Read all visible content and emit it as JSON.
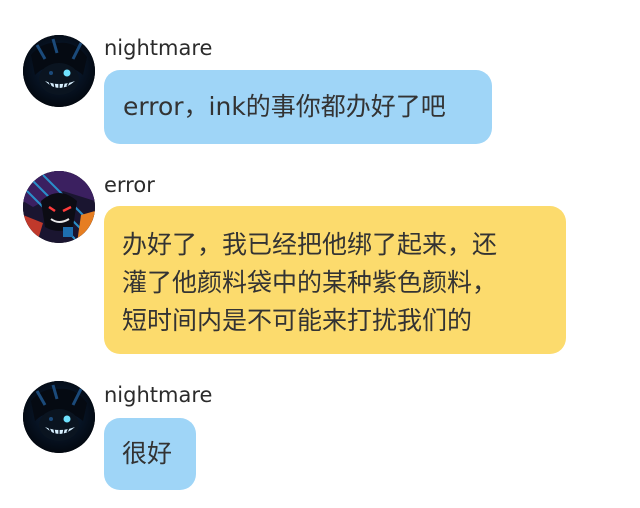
{
  "colors": {
    "bubble_blue": "#9fd5f7",
    "bubble_yellow": "#fcdb6d",
    "text": "#333333",
    "background": "#ffffff"
  },
  "messages": [
    {
      "sender": "nightmare",
      "avatar": "nightmare-avatar",
      "bubble_color": "blue",
      "text": "error，ink的事你都办好了吧"
    },
    {
      "sender": "error",
      "avatar": "error-avatar",
      "bubble_color": "yellow",
      "lines": [
        "办好了，我已经把他绑了起来，还",
        "灌了他颜料袋中的某种紫色颜料，",
        "短时间内是不可能来打扰我们的"
      ]
    },
    {
      "sender": "nightmare",
      "avatar": "nightmare-avatar",
      "bubble_color": "blue",
      "text": "很好"
    }
  ]
}
